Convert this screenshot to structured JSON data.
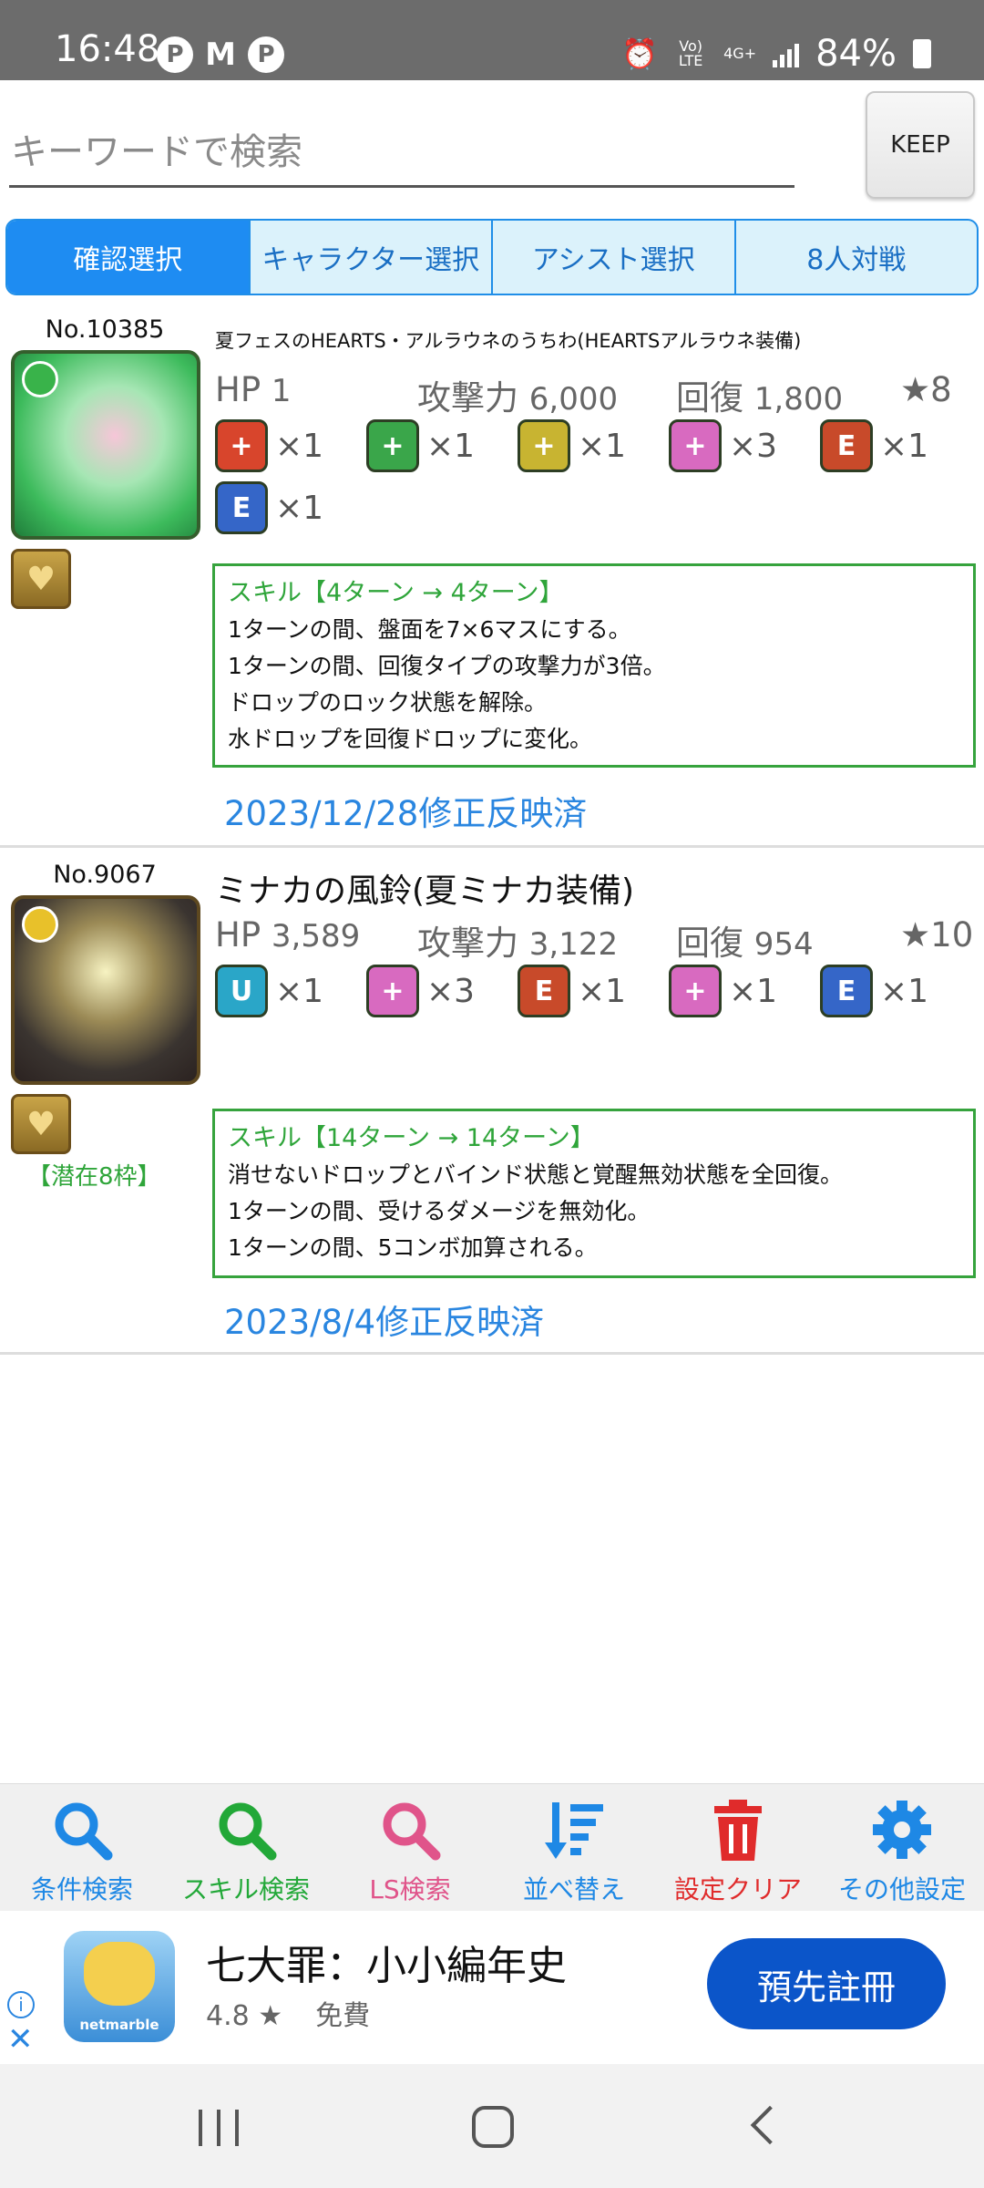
{
  "status_bar": {
    "time": "16:48",
    "notification_icons": [
      "P",
      "M",
      "P"
    ],
    "volte": "Vo) LTE",
    "network": "4G+",
    "battery": "84%"
  },
  "search": {
    "placeholder": "キーワードで検索",
    "keep_label": "KEEP"
  },
  "tabs": [
    {
      "label": "確認選択",
      "active": true
    },
    {
      "label": "キャラクター選択",
      "active": false
    },
    {
      "label": "アシスト選択",
      "active": false
    },
    {
      "label": "8人対戦",
      "active": false
    }
  ],
  "cards": [
    {
      "number": "No.10385",
      "name": "夏フェスのHEARTS・アルラウネのうちわ(HEARTSアルラウネ装備)",
      "hp_label": "HP",
      "hp": "1",
      "atk_label": "攻撃力",
      "atk": "6,000",
      "rcv_label": "回復",
      "rcv": "1,800",
      "rarity": "★8",
      "awakenings": [
        {
          "icon": "fire-plus-icon",
          "count": "×1"
        },
        {
          "icon": "wood-plus-icon",
          "count": "×1"
        },
        {
          "icon": "light-plus-icon",
          "count": "×1"
        },
        {
          "icon": "team-heal-icon",
          "count": "×3"
        },
        {
          "icon": "heart-e-icon",
          "count": "×1"
        },
        {
          "icon": "sword-e-icon",
          "count": "×1"
        }
      ],
      "skill_header": "スキル【4ターン → 4ターン】",
      "skill_lines": [
        "1ターンの間、盤面を7×6マスにする。",
        "1ターンの間、回復タイプの攻撃力が3倍。",
        "ドロップのロック状態を解除。",
        "水ドロップを回復ドロップに変化。"
      ],
      "date": "2023/12/28修正反映済"
    },
    {
      "number": "No.9067",
      "name": "ミナカの風鈴(夏ミナカ装備)",
      "hp_label": "HP",
      "hp": "3,589",
      "atk_label": "攻撃力",
      "atk": "3,122",
      "rcv_label": "回復",
      "rcv": "954",
      "rarity": "★10",
      "awakenings": [
        {
          "icon": "bind-resist-icon",
          "count": "×1"
        },
        {
          "icon": "team-heal-icon",
          "count": "×3"
        },
        {
          "icon": "heart-e-icon",
          "count": "×1"
        },
        {
          "icon": "heart-plus-icon",
          "count": "×1"
        },
        {
          "icon": "sword-e-icon",
          "count": "×1"
        }
      ],
      "latent": "【潜在8枠】",
      "skill_header": "スキル【14ターン → 14ターン】",
      "skill_lines": [
        "消せないドロップとバインド状態と覚醒無効状態を全回復。",
        "1ターンの間、受けるダメージを無効化。",
        "1ターンの間、5コンボ加算される。"
      ],
      "date": "2023/8/4修正反映済"
    }
  ],
  "bottom_nav": [
    {
      "label": "条件検索",
      "color": "#1e88e5"
    },
    {
      "label": "スキル検索",
      "color": "#22a838"
    },
    {
      "label": "LS検索",
      "color": "#e0548a"
    },
    {
      "label": "並べ替え",
      "color": "#1e88e5"
    },
    {
      "label": "設定クリア",
      "color": "#e02b2b"
    },
    {
      "label": "その他設定",
      "color": "#1e88e5"
    }
  ],
  "ad": {
    "app_name": "七大罪：小小編年史",
    "rating": "4.8 ★",
    "price": "免費",
    "cta": "預先註冊",
    "icon_logo": "netmarble"
  }
}
